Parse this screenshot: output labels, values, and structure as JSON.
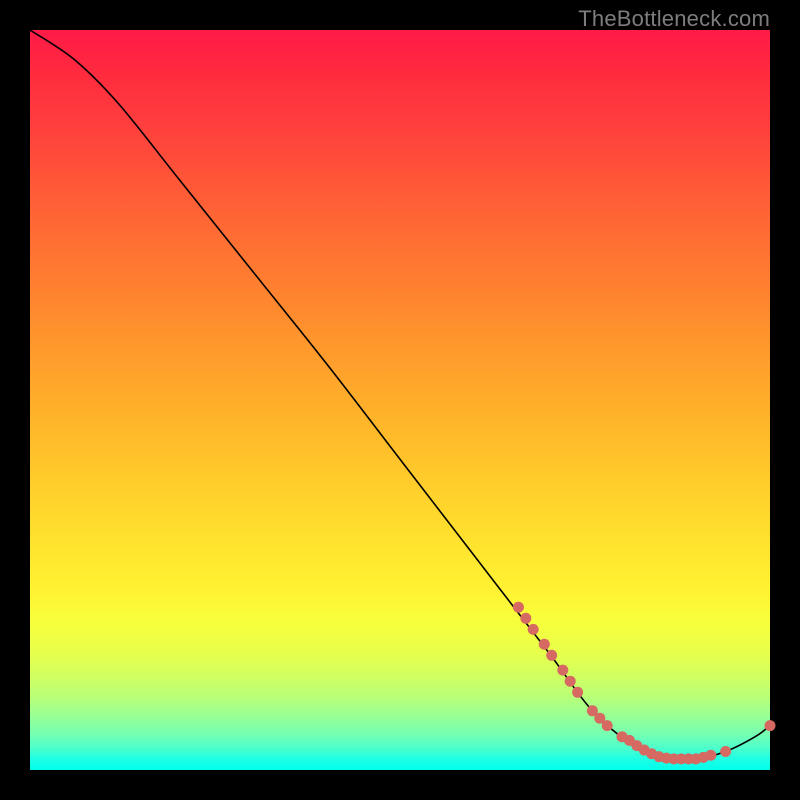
{
  "attribution": "TheBottleneck.com",
  "chart_data": {
    "type": "line",
    "title": "",
    "xlabel": "",
    "ylabel": "",
    "xlim": [
      0,
      100
    ],
    "ylim": [
      0,
      100
    ],
    "curve": {
      "points": [
        {
          "x": 0,
          "y": 100
        },
        {
          "x": 6,
          "y": 96
        },
        {
          "x": 12,
          "y": 90
        },
        {
          "x": 20,
          "y": 80
        },
        {
          "x": 30,
          "y": 67.5
        },
        {
          "x": 40,
          "y": 55
        },
        {
          "x": 50,
          "y": 42
        },
        {
          "x": 60,
          "y": 29
        },
        {
          "x": 70,
          "y": 16
        },
        {
          "x": 76,
          "y": 8
        },
        {
          "x": 82,
          "y": 3
        },
        {
          "x": 86,
          "y": 1.5
        },
        {
          "x": 90,
          "y": 1.5
        },
        {
          "x": 94,
          "y": 2.5
        },
        {
          "x": 98,
          "y": 4.5
        },
        {
          "x": 100,
          "y": 6
        }
      ],
      "stroke": "#000000",
      "stroke_width": 1.6
    },
    "markers": {
      "color": "#d66a62",
      "radius": 5.5,
      "points": [
        {
          "x": 66,
          "y": 22
        },
        {
          "x": 67,
          "y": 20.5
        },
        {
          "x": 68,
          "y": 19
        },
        {
          "x": 69.5,
          "y": 17
        },
        {
          "x": 70.5,
          "y": 15.5
        },
        {
          "x": 72,
          "y": 13.5
        },
        {
          "x": 73,
          "y": 12
        },
        {
          "x": 74,
          "y": 10.5
        },
        {
          "x": 76,
          "y": 8
        },
        {
          "x": 77,
          "y": 7
        },
        {
          "x": 78,
          "y": 6
        },
        {
          "x": 80,
          "y": 4.5
        },
        {
          "x": 81,
          "y": 4
        },
        {
          "x": 82,
          "y": 3.3
        },
        {
          "x": 83,
          "y": 2.7
        },
        {
          "x": 84,
          "y": 2.2
        },
        {
          "x": 85,
          "y": 1.8
        },
        {
          "x": 86,
          "y": 1.6
        },
        {
          "x": 87,
          "y": 1.5
        },
        {
          "x": 88,
          "y": 1.5
        },
        {
          "x": 89,
          "y": 1.5
        },
        {
          "x": 90,
          "y": 1.5
        },
        {
          "x": 91,
          "y": 1.7
        },
        {
          "x": 92,
          "y": 2
        },
        {
          "x": 94,
          "y": 2.5
        },
        {
          "x": 100,
          "y": 6
        }
      ]
    }
  }
}
